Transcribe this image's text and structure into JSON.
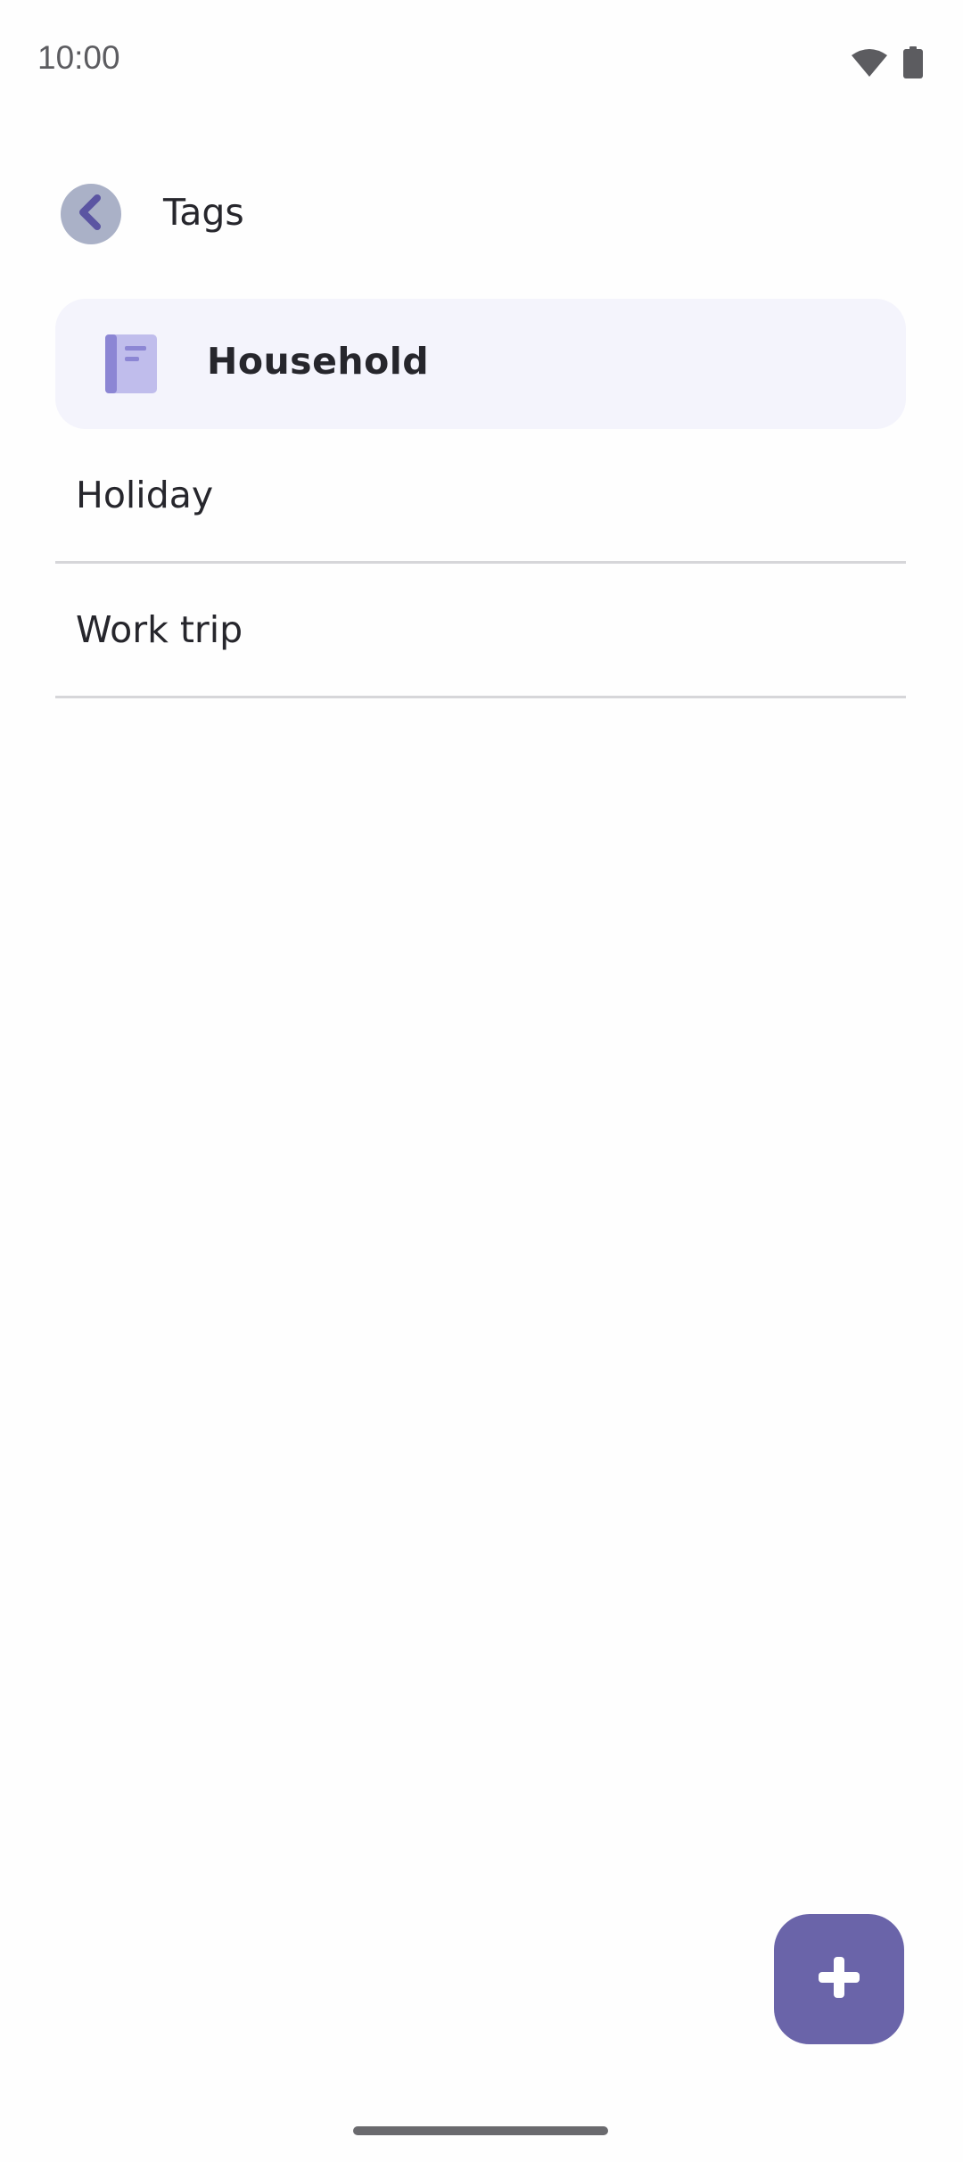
{
  "status_bar": {
    "time": "10:00",
    "icons": [
      "wifi-icon",
      "battery-icon"
    ]
  },
  "app_bar": {
    "title": "Tags",
    "back_icon": "chevron-left-icon"
  },
  "tags": {
    "selected": {
      "label": "Household",
      "icon": "book-icon"
    },
    "items": [
      {
        "label": "Holiday"
      },
      {
        "label": "Work trip"
      }
    ]
  },
  "fab": {
    "icon": "plus-icon"
  },
  "colors": {
    "accent": "#6a64a9",
    "selected_bg": "#f4f4fc",
    "back_button_bg": "#aab1c7",
    "book_icon_light": "#c0bdec",
    "book_icon_dark": "#8c86d4",
    "divider": "#d6d6d9"
  }
}
